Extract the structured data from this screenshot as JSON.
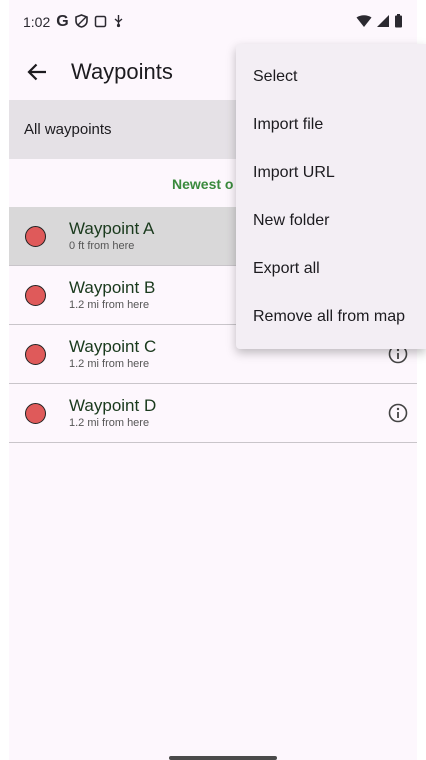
{
  "status_bar": {
    "time": "1:02",
    "icons": [
      "google-g-icon",
      "shield-icon",
      "screen-icon",
      "usb-debug-icon"
    ],
    "right_icons": [
      "wifi-icon",
      "signal-icon",
      "battery-icon"
    ]
  },
  "app_bar": {
    "title": "Waypoints"
  },
  "folder_bar": {
    "label": "All waypoints"
  },
  "sort": {
    "label": "Newest o"
  },
  "waypoints": [
    {
      "name": "Waypoint A",
      "distance": "0 ft from here",
      "selected": true
    },
    {
      "name": "Waypoint B",
      "distance": "1.2 mi from here",
      "selected": false
    },
    {
      "name": "Waypoint C",
      "distance": "1.2 mi from here",
      "selected": false
    },
    {
      "name": "Waypoint D",
      "distance": "1.2 mi from here",
      "selected": false
    }
  ],
  "menu": {
    "items": [
      "Select",
      "Import file",
      "Import URL",
      "New folder",
      "Export all",
      "Remove all from map"
    ]
  },
  "colors": {
    "accent_green": "#3a8a3d",
    "waypoint_dot": "#df5a5a",
    "background": "#fdf7fd"
  }
}
